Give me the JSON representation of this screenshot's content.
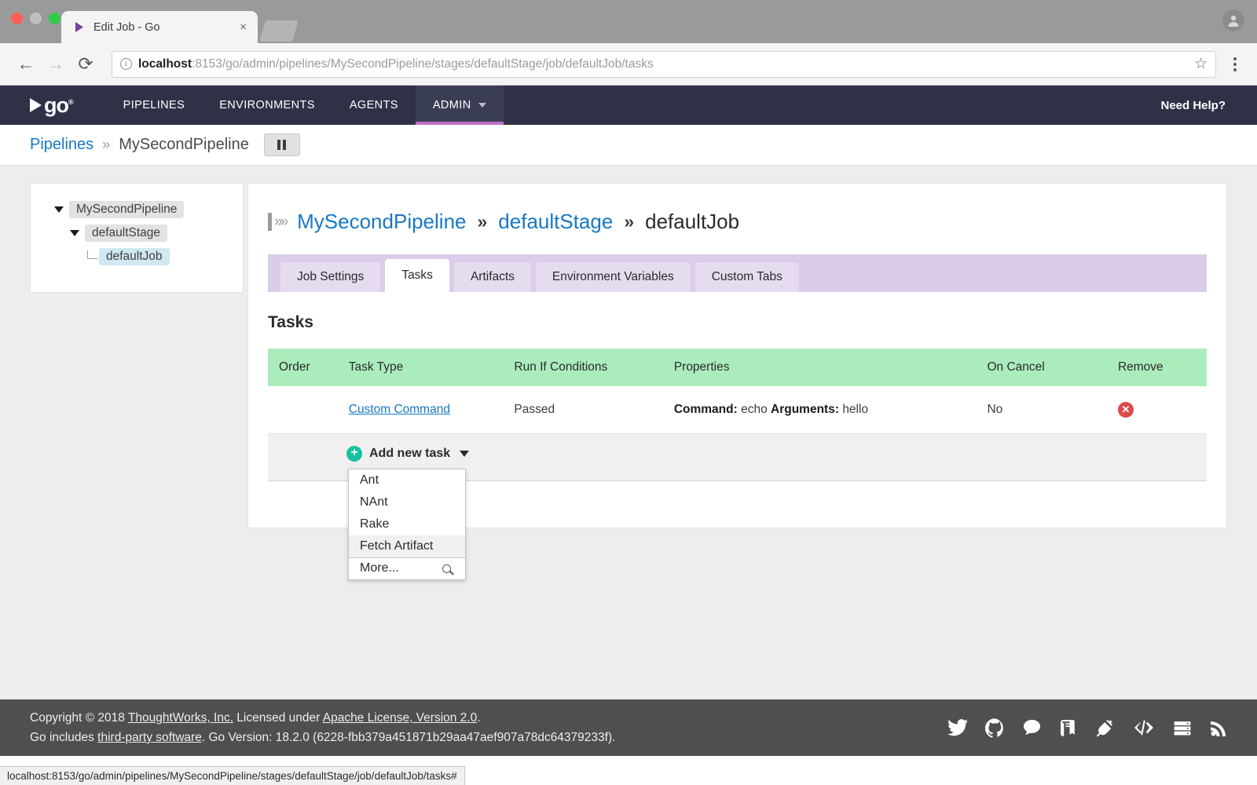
{
  "browser": {
    "tab_title": "Edit Job - Go",
    "tab_close_label": "×",
    "url_host": "localhost",
    "url_rest": ":8153/go/admin/pipelines/MySecondPipeline/stages/defaultStage/job/defaultJob/tasks",
    "back_label": "←",
    "forward_label": "→",
    "reload_label": "⟳",
    "info_label": "i",
    "star_label": "☆",
    "status_url": "localhost:8153/go/admin/pipelines/MySecondPipeline/stages/defaultStage/job/defaultJob/tasks#"
  },
  "topnav": {
    "logo_text": "go",
    "logo_sup": "®",
    "items": [
      {
        "label": "PIPELINES",
        "active": false
      },
      {
        "label": "ENVIRONMENTS",
        "active": false
      },
      {
        "label": "AGENTS",
        "active": false
      },
      {
        "label": "ADMIN",
        "active": true
      }
    ],
    "need_help": "Need Help?",
    "accent_color": "#c06ec6"
  },
  "breadcrumb": {
    "root": "Pipelines",
    "separator": "»",
    "current": "MySecondPipeline",
    "pause_button_name": "pause"
  },
  "sidebar": {
    "nodes": [
      {
        "label": "MySecondPipeline",
        "level": 1,
        "state": "expanded",
        "selected": false
      },
      {
        "label": "defaultStage",
        "level": 2,
        "state": "expanded",
        "selected": false
      },
      {
        "label": "defaultJob",
        "level": 3,
        "state": "leaf",
        "selected": true
      }
    ]
  },
  "main": {
    "title": {
      "pipeline": "MySecondPipeline",
      "sep1": "»",
      "stage": "defaultStage",
      "sep2": "»",
      "job": "defaultJob"
    },
    "tabs": [
      {
        "label": "Job Settings",
        "active": false
      },
      {
        "label": "Tasks",
        "active": true
      },
      {
        "label": "Artifacts",
        "active": false
      },
      {
        "label": "Environment Variables",
        "active": false
      },
      {
        "label": "Custom Tabs",
        "active": false
      }
    ],
    "section_title": "Tasks",
    "table": {
      "headers": [
        "Order",
        "Task Type",
        "Run If Conditions",
        "Properties",
        "On Cancel",
        "Remove"
      ],
      "header_bg": "#abecbd",
      "rows": [
        {
          "order": "",
          "task_type": "Custom Command",
          "run_if": "Passed",
          "props_label_1": "Command:",
          "props_value_1": "echo",
          "props_label_2": "Arguments:",
          "props_value_2": "hello",
          "on_cancel": "No",
          "remove_label": "✕"
        }
      ]
    },
    "add_task": {
      "label": "Add new task",
      "plus": "+",
      "menu": [
        {
          "label": "Ant",
          "highlighted": false
        },
        {
          "label": "NAnt",
          "highlighted": false
        },
        {
          "label": "Rake",
          "highlighted": false
        },
        {
          "label": "Fetch Artifact",
          "highlighted": true
        },
        {
          "label": "More...",
          "highlighted": false,
          "icon": "search-icon"
        }
      ]
    }
  },
  "footer": {
    "line1_pre": "Copyright © 2018 ",
    "line1_link1": "ThoughtWorks, Inc.",
    "line1_mid": " Licensed under ",
    "line1_link2": "Apache License, Version 2.0",
    "line1_post": ".",
    "line2_pre": "Go includes ",
    "line2_link": "third-party software",
    "line2_post": ". Go Version: 18.2.0 (6228-fbb379a451871b29aa47aef907a78dc64379233f).",
    "icons": [
      "twitter-icon",
      "github-icon",
      "chat-icon",
      "book-icon",
      "plug-icon",
      "code-icon",
      "server-icon",
      "rss-icon"
    ]
  }
}
